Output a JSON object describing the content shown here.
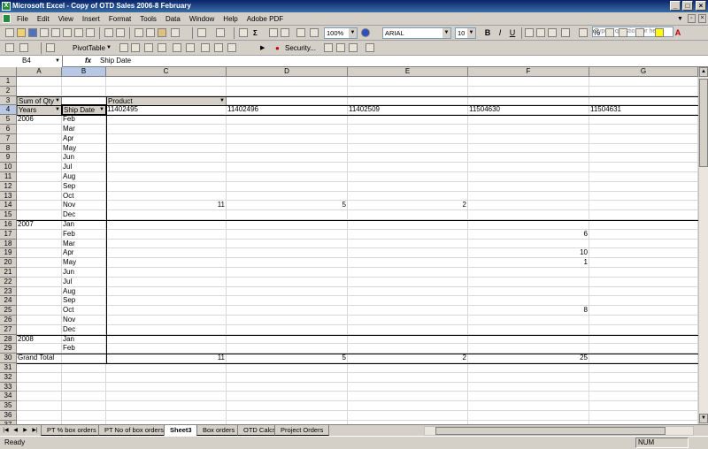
{
  "window": {
    "title": "Microsoft Excel - Copy of OTD Sales 2006-8 February"
  },
  "menu": {
    "items": [
      "File",
      "Edit",
      "View",
      "Insert",
      "Format",
      "Tools",
      "Data",
      "Window",
      "Help",
      "Adobe PDF"
    ],
    "ask_placeholder": "Type a question for help"
  },
  "toolbar": {
    "zoom": "100%",
    "font": "ARIAL",
    "font_size": "10",
    "bold": "B",
    "italic": "I",
    "underline": "U",
    "percent": "%",
    "pivottable_label": "PivotTable",
    "security_label": "Security..."
  },
  "formula_bar": {
    "name_box": "B4",
    "fx": "fx",
    "content": "Ship Date"
  },
  "columns": [
    "A",
    "B",
    "C",
    "D",
    "E",
    "F",
    "G"
  ],
  "selected_column": "B",
  "selected_row": 4,
  "pivot": {
    "data_field": "Sum of Qty",
    "column_field": "Product",
    "row_field_1": "Years",
    "row_field_2": "Ship Date",
    "products": [
      "11402495",
      "11402496",
      "11402509",
      "11504630",
      "11504631"
    ],
    "rows": [
      {
        "row": 5,
        "year": "2006",
        "month": "Feb"
      },
      {
        "row": 6,
        "month": "Mar"
      },
      {
        "row": 7,
        "month": "Apr"
      },
      {
        "row": 8,
        "month": "May"
      },
      {
        "row": 9,
        "month": "Jun"
      },
      {
        "row": 10,
        "month": "Jul"
      },
      {
        "row": 11,
        "month": "Aug"
      },
      {
        "row": 12,
        "month": "Sep"
      },
      {
        "row": 13,
        "month": "Oct"
      },
      {
        "row": 14,
        "month": "Nov",
        "C": "11",
        "D": "5",
        "E": "2"
      },
      {
        "row": 15,
        "month": "Dec"
      },
      {
        "row": 16,
        "year": "2007",
        "month": "Jan"
      },
      {
        "row": 17,
        "month": "Feb",
        "F": "6"
      },
      {
        "row": 18,
        "month": "Mar"
      },
      {
        "row": 19,
        "month": "Apr",
        "F": "10"
      },
      {
        "row": 20,
        "month": "May",
        "F": "1"
      },
      {
        "row": 21,
        "month": "Jun"
      },
      {
        "row": 22,
        "month": "Jul"
      },
      {
        "row": 23,
        "month": "Aug"
      },
      {
        "row": 24,
        "month": "Sep"
      },
      {
        "row": 25,
        "month": "Oct",
        "F": "8"
      },
      {
        "row": 26,
        "month": "Nov"
      },
      {
        "row": 27,
        "month": "Dec"
      },
      {
        "row": 28,
        "year": "2008",
        "month": "Jan"
      },
      {
        "row": 29,
        "month": "Feb"
      }
    ],
    "grand_total": {
      "label": "Grand Total",
      "C": "11",
      "D": "5",
      "E": "2",
      "F": "25"
    }
  },
  "tabs": [
    "PT % box orders",
    "PT No of box orders",
    "Sheet3",
    "Box orders",
    "OTD Calcs",
    "Project Orders"
  ],
  "active_tab": "Sheet3",
  "status": {
    "ready": "Ready",
    "num": "NUM"
  }
}
